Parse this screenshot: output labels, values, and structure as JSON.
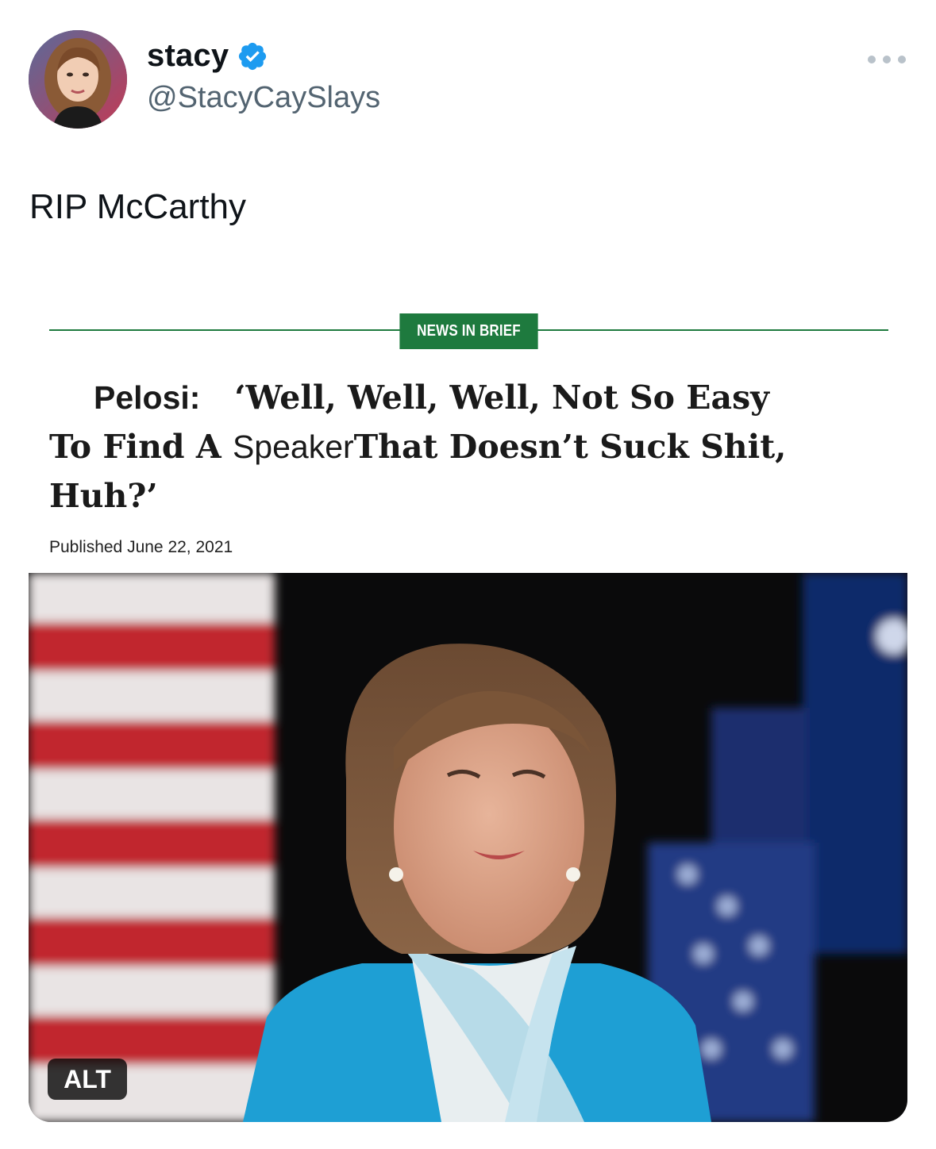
{
  "author": {
    "display_name": "stacy",
    "handle": "@StacyCaySlays",
    "verified": true,
    "avatar_icon": "profile-photo"
  },
  "tweet": {
    "text": "RIP McCarthy"
  },
  "media": {
    "section_label": "NEWS IN BRIEF",
    "headline": {
      "line1_a": "Pelosi:",
      "line1_b": "‘Well, Well, Well, Not So Easy",
      "line2_a": "To Find A ",
      "line2_b": "Speaker",
      "line2_c": "That Doesn’t Suck Shit,",
      "line3": "Huh?’"
    },
    "published": "Published June 22, 2021",
    "alt_label": "ALT"
  },
  "colors": {
    "accent_green": "#1e7a3e",
    "verified_blue": "#1d9bf0",
    "handle_gray": "#536471"
  }
}
